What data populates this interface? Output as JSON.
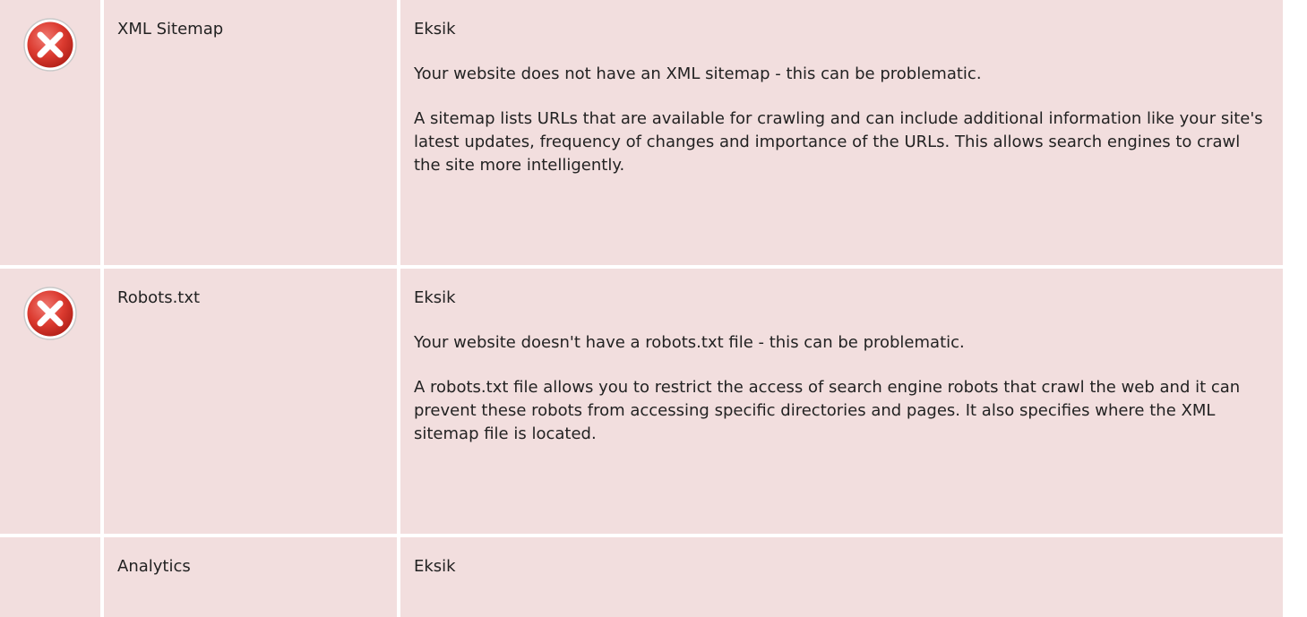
{
  "rows": [
    {
      "status": "error",
      "icon": "error-x-icon",
      "name": "XML Sitemap",
      "value": "Eksik",
      "paragraphs": [
        "Your website does not have an XML sitemap - this can be problematic.",
        "A sitemap lists URLs that are available for crawling and can include additional information like your site's latest updates, frequency of changes and importance of the URLs. This allows search engines to crawl the site more intelligently."
      ]
    },
    {
      "status": "error",
      "icon": "error-x-icon",
      "name": "Robots.txt",
      "value": "Eksik",
      "paragraphs": [
        "Your website doesn't have a robots.txt file - this can be problematic.",
        "A robots.txt file allows you to restrict the access of search engine robots that crawl the web and it can prevent these robots from accessing specific directories and pages. It also specifies where the XML sitemap file is located."
      ]
    },
    {
      "status": "unknown",
      "icon": "",
      "name": "Analytics",
      "value": "Eksik",
      "paragraphs": []
    }
  ],
  "colors": {
    "row_background": "#f2dede",
    "icon_red": "#d9534f",
    "text": "#222222"
  }
}
